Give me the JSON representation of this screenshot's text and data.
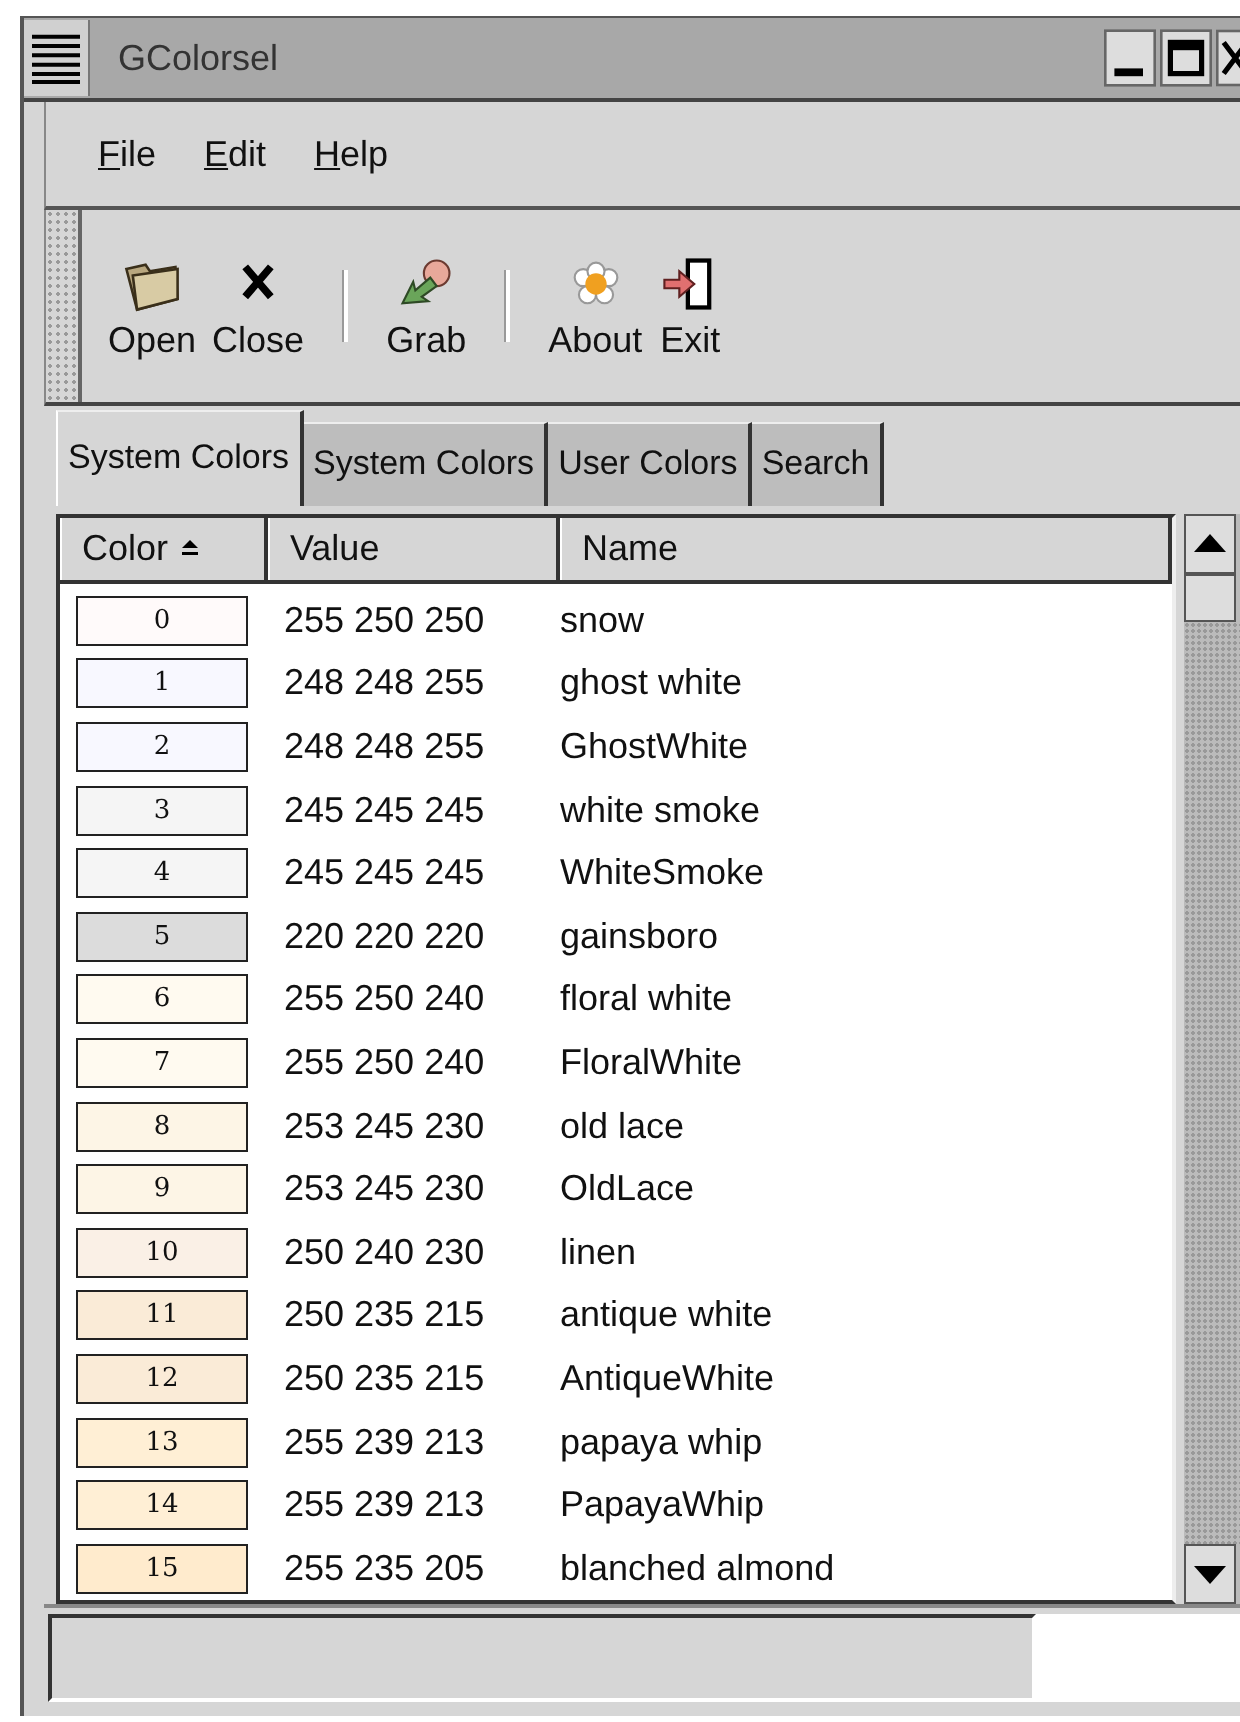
{
  "window": {
    "title": "GColorsel"
  },
  "menu": [
    {
      "label": "File",
      "mnemonic": true
    },
    {
      "label": "Edit",
      "mnemonic": true
    },
    {
      "label": "Help",
      "mnemonic": true
    }
  ],
  "toolbar": [
    {
      "kind": "open",
      "label": "Open"
    },
    {
      "kind": "close",
      "label": "Close"
    },
    {
      "kind": "separator"
    },
    {
      "kind": "grab",
      "label": "Grab"
    },
    {
      "kind": "separator"
    },
    {
      "kind": "about",
      "label": "About"
    },
    {
      "kind": "exit",
      "label": "Exit"
    }
  ],
  "tabs": [
    {
      "label": "System Colors",
      "selected": true
    },
    {
      "label": "System Colors",
      "selected": false
    },
    {
      "label": "User Colors",
      "selected": false
    },
    {
      "label": "Search",
      "selected": false
    }
  ],
  "table": {
    "columns": [
      {
        "label": "Color",
        "sorted": true
      },
      {
        "label": "Value",
        "sorted": false
      },
      {
        "label": "Name",
        "sorted": false
      }
    ],
    "rows": [
      {
        "index": "0",
        "value": "255 250 250",
        "name": "snow",
        "color": "#fffafa"
      },
      {
        "index": "1",
        "value": "248 248 255",
        "name": "ghost white",
        "color": "#f8f8ff"
      },
      {
        "index": "2",
        "value": "248 248 255",
        "name": "GhostWhite",
        "color": "#f8f8ff"
      },
      {
        "index": "3",
        "value": "245 245 245",
        "name": "white smoke",
        "color": "#f5f5f5"
      },
      {
        "index": "4",
        "value": "245 245 245",
        "name": "WhiteSmoke",
        "color": "#f5f5f5"
      },
      {
        "index": "5",
        "value": "220 220 220",
        "name": "gainsboro",
        "color": "#dcdcdc"
      },
      {
        "index": "6",
        "value": "255 250 240",
        "name": "floral white",
        "color": "#fffaf0"
      },
      {
        "index": "7",
        "value": "255 250 240",
        "name": "FloralWhite",
        "color": "#fffaf0"
      },
      {
        "index": "8",
        "value": "253 245 230",
        "name": "old lace",
        "color": "#fdf5e6"
      },
      {
        "index": "9",
        "value": "253 245 230",
        "name": "OldLace",
        "color": "#fdf5e6"
      },
      {
        "index": "10",
        "value": "250 240 230",
        "name": "linen",
        "color": "#faf0e6"
      },
      {
        "index": "11",
        "value": "250 235 215",
        "name": "antique white",
        "color": "#faebd7"
      },
      {
        "index": "12",
        "value": "250 235 215",
        "name": "AntiqueWhite",
        "color": "#faebd7"
      },
      {
        "index": "13",
        "value": "255 239 213",
        "name": "papaya whip",
        "color": "#ffefd5"
      },
      {
        "index": "14",
        "value": "255 239 213",
        "name": "PapayaWhip",
        "color": "#ffefd5"
      },
      {
        "index": "15",
        "value": "255 235 205",
        "name": "blanched almond",
        "color": "#ffebcd"
      }
    ]
  }
}
